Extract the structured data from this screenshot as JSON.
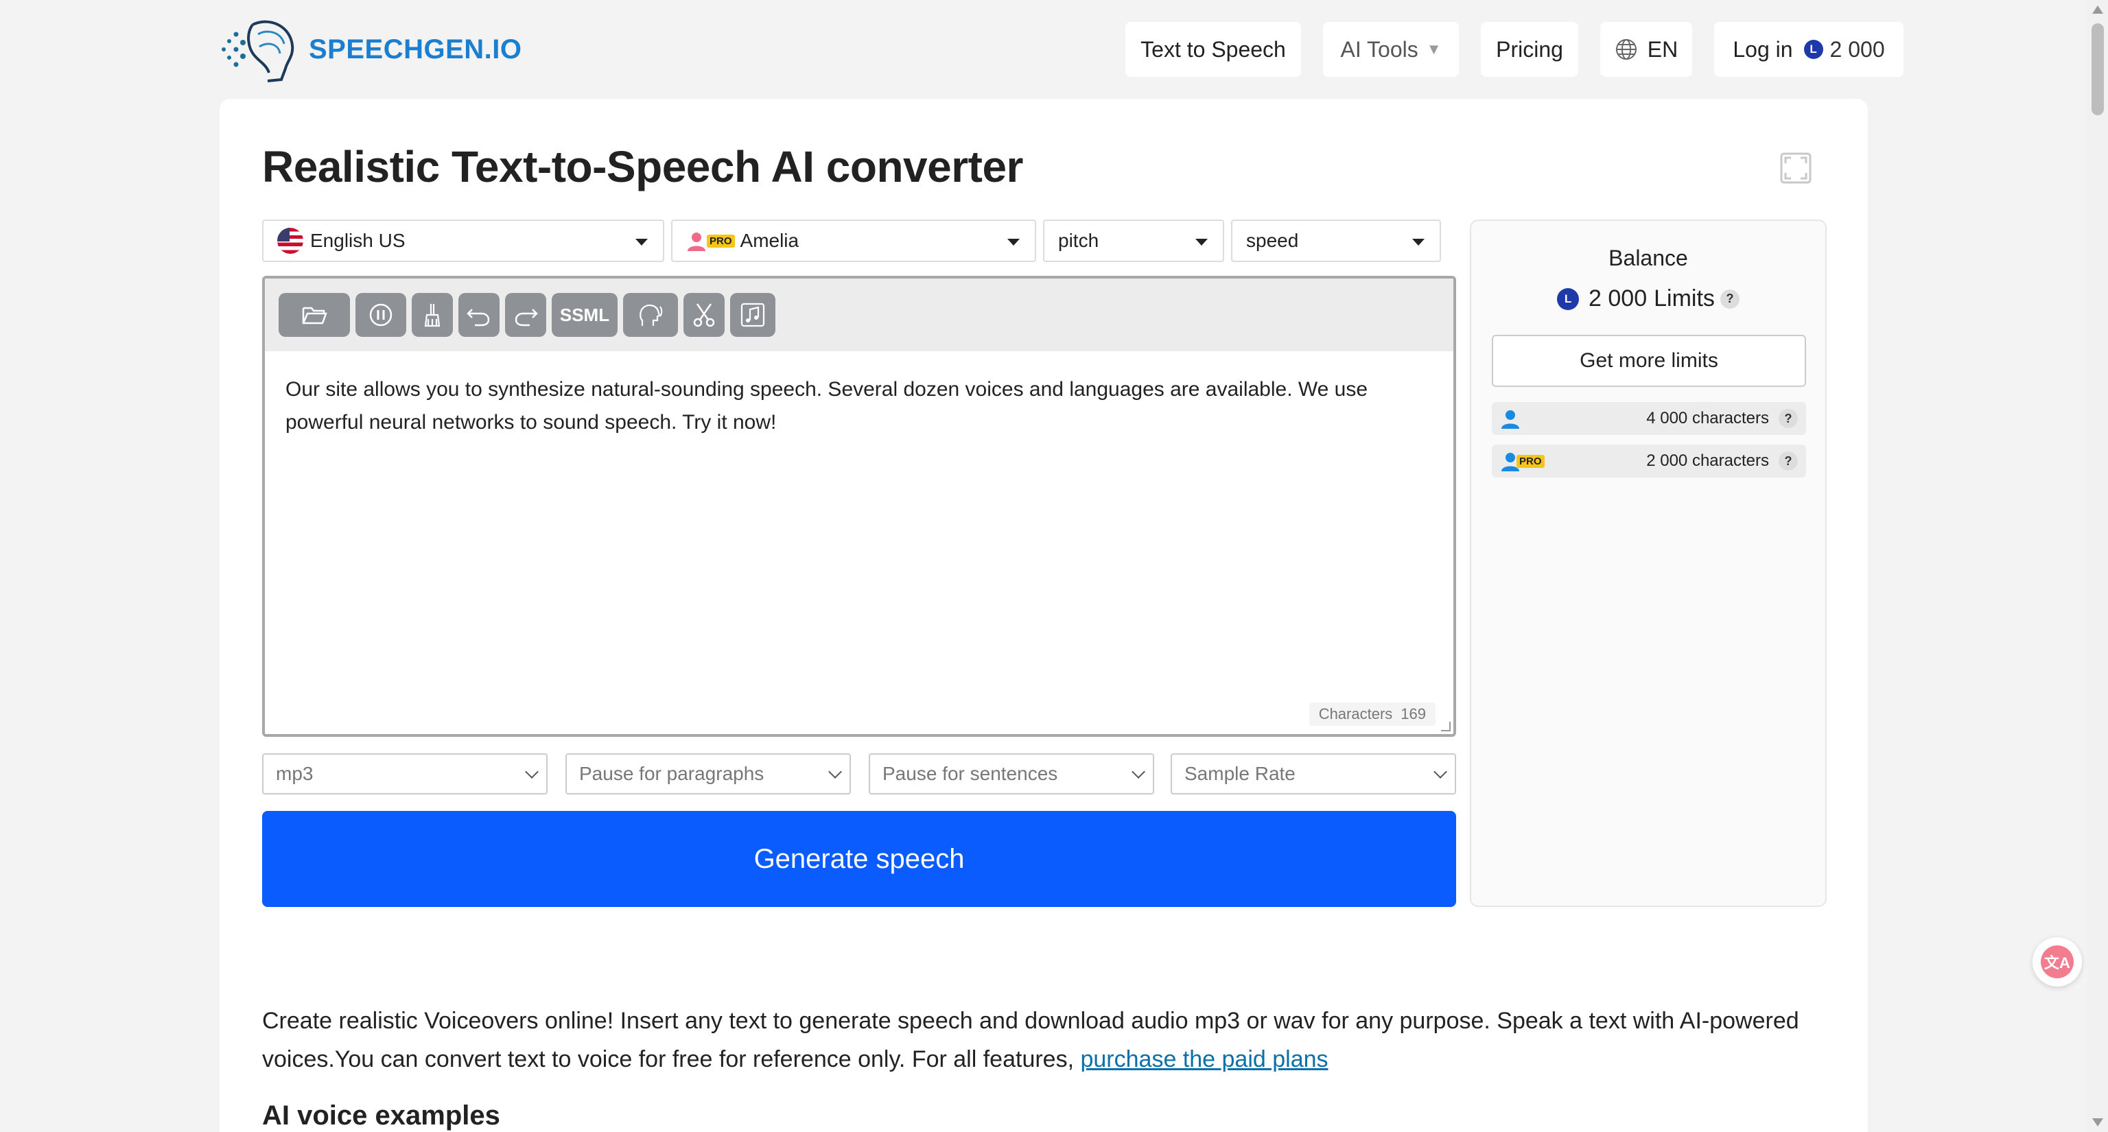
{
  "header": {
    "logo_text": "SPEECHGEN.IO",
    "nav": {
      "text_to_speech": "Text to Speech",
      "ai_tools": "AI Tools",
      "pricing": "Pricing",
      "language": "EN",
      "login": "Log in",
      "login_balance": "2 000",
      "coin_letter": "L"
    }
  },
  "main": {
    "title": "Realistic Text-to-Speech AI converter",
    "selectors": {
      "language": "English US",
      "voice": "Amelia",
      "voice_badge": "PRO",
      "pitch": "pitch",
      "speed": "speed"
    },
    "toolbar": {
      "ssml_label": "SSML"
    },
    "editor": {
      "text": "Our site allows you to synthesize natural-sounding speech. Several dozen voices and languages are available. We use powerful neural networks to sound speech. Try it now!",
      "char_label": "Characters",
      "char_count": "169"
    },
    "options": {
      "format": "mp3",
      "pause_paragraphs": "Pause for paragraphs",
      "pause_sentences": "Pause for sentences",
      "sample_rate": "Sample Rate"
    },
    "generate_label": "Generate speech"
  },
  "balance": {
    "title": "Balance",
    "amount": "2 000",
    "unit": "Limits",
    "coin_letter": "L",
    "more_label": "Get more limits",
    "limits": [
      {
        "text": "4 000 characters"
      },
      {
        "text": "2 000 characters",
        "badge": "PRO"
      }
    ],
    "help_symbol": "?"
  },
  "content": {
    "description": "Create realistic Voiceovers online! Insert any text to generate speech and download audio mp3 or wav for any purpose. Speak a text with AI-powered voices.You can convert text to voice for free for reference only. For all features,",
    "link_text": "purchase the paid plans",
    "subheading": "AI voice examples"
  },
  "colors": {
    "accent": "#0b5cff",
    "brand": "#1a7fd0",
    "coin": "#1e3aa8",
    "pro_badge": "#f5c518"
  },
  "icons": [
    "folder-open-icon",
    "pause-icon",
    "broom-icon",
    "undo-icon",
    "redo-icon",
    "voice-head-icon",
    "scissors-icon",
    "music-icon",
    "globe-icon",
    "fullscreen-icon",
    "user-icon",
    "translate-icon"
  ]
}
